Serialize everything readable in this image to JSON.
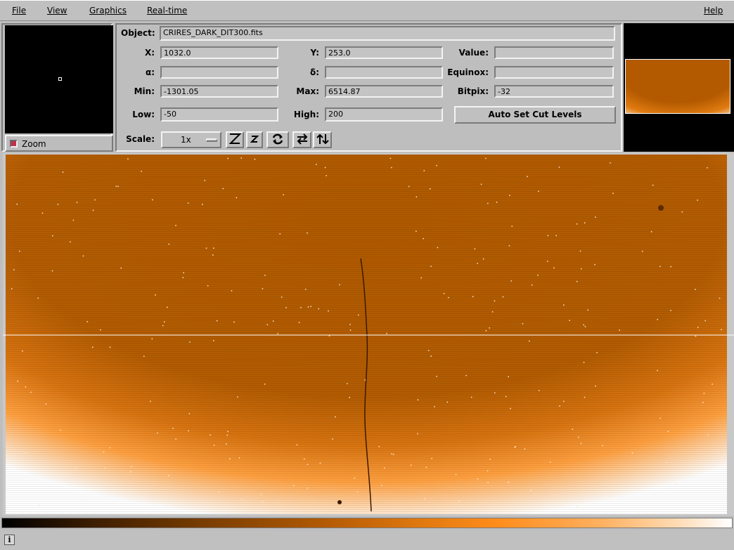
{
  "menubar": {
    "file": "File",
    "view": "View",
    "graphics": "Graphics",
    "realtime": "Real-time",
    "help": "Help"
  },
  "zoom": {
    "label": "Zoom"
  },
  "info": {
    "object_label": "Object:",
    "object_value": "CRIRES_DARK_DIT300.fits",
    "x_label": "X:",
    "x_value": "1032.0",
    "y_label": "Y:",
    "y_value": "253.0",
    "value_label": "Value:",
    "value_value": "",
    "alpha_label": "α:",
    "alpha_value": "",
    "delta_label": "δ:",
    "delta_value": "",
    "equinox_label": "Equinox:",
    "equinox_value": "",
    "min_label": "Min:",
    "min_value": "-1301.05",
    "max_label": "Max:",
    "max_value": "6514.87",
    "bitpix_label": "Bitpix:",
    "bitpix_value": "-32",
    "low_label": "Low:",
    "low_value": "-50",
    "high_label": "High:",
    "high_value": "200",
    "auto_cut_button": "Auto Set Cut Levels",
    "scale_label": "Scale:",
    "scale_value": "1x"
  },
  "toolbar_icons": [
    "zoom-in-icon",
    "zoom-out-icon",
    "rotate-icon",
    "flip-x-icon",
    "flip-y-icon"
  ],
  "colors": {
    "image_base": "#b05a00",
    "image_edge": "#ffffff",
    "panel": "#bebebe"
  },
  "status": {
    "icon": "i"
  }
}
